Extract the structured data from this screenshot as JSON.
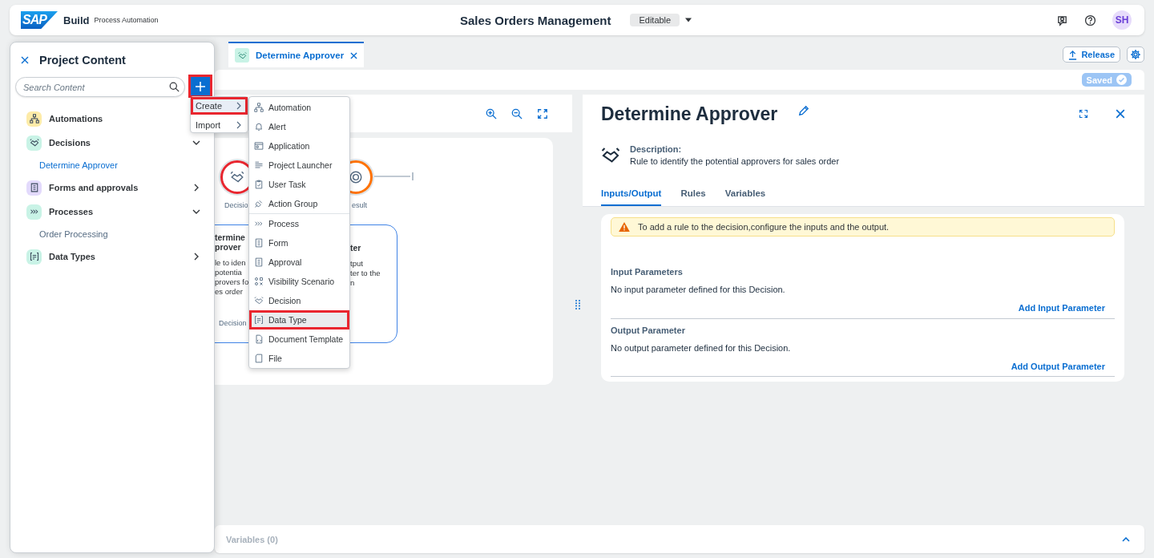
{
  "header": {
    "logo": "SAP",
    "product": "Build",
    "subtitle": "Process Automation",
    "title": "Sales Orders Management",
    "mode": "Editable",
    "user_initials": "SH"
  },
  "tabs": [
    {
      "label": "Determine Approver",
      "selected": true
    }
  ],
  "actions": {
    "release": "Release",
    "status": "Saved"
  },
  "project_panel": {
    "title": "Project Content",
    "search": {
      "placeholder": "Search Content"
    },
    "tree": [
      {
        "label": "Automations",
        "kind": "automation",
        "color": "#fdeba8"
      },
      {
        "label": "Decisions",
        "kind": "decision",
        "color": "#c9f3e6",
        "expanded": true,
        "children": [
          {
            "label": "Determine Approver",
            "selected": true
          }
        ]
      },
      {
        "label": "Forms and approvals",
        "kind": "form",
        "color": "#e3dafc",
        "expanded": false
      },
      {
        "label": "Processes",
        "kind": "process",
        "color": "#c9f3e6",
        "expanded": true,
        "children": [
          {
            "label": "Order Processing",
            "selected": false
          }
        ]
      },
      {
        "label": "Data Types",
        "kind": "data-type",
        "color": "#c9f3e6",
        "expanded": false
      }
    ]
  },
  "add_button": {
    "highlighted": true
  },
  "add_menu": [
    {
      "label": "Create",
      "highlighted": true
    },
    {
      "label": "Import",
      "highlighted": false
    }
  ],
  "create_menu": [
    [
      {
        "label": "Automation",
        "kind": "automation",
        "highlighted": false
      },
      {
        "label": "Alert",
        "kind": "alert",
        "highlighted": false
      },
      {
        "label": "Application",
        "kind": "application",
        "highlighted": false
      },
      {
        "label": "Project Launcher",
        "kind": "project-launcher",
        "highlighted": false
      },
      {
        "label": "User Task",
        "kind": "user-task",
        "highlighted": false
      },
      {
        "label": "Action Group",
        "kind": "action-group",
        "highlighted": false
      }
    ],
    [
      {
        "label": "Process",
        "kind": "process",
        "highlighted": false
      },
      {
        "label": "Form",
        "kind": "form",
        "highlighted": false
      },
      {
        "label": "Approval",
        "kind": "approval",
        "highlighted": false
      },
      {
        "label": "Visibility Scenario",
        "kind": "visibility-scenario",
        "highlighted": false
      },
      {
        "label": "Decision",
        "kind": "decision",
        "highlighted": false
      },
      {
        "label": "Data Type",
        "kind": "data-type",
        "highlighted": true
      },
      {
        "label": "Document Template",
        "kind": "document-template",
        "highlighted": false
      },
      {
        "label": "File",
        "kind": "file",
        "highlighted": false
      }
    ]
  ],
  "canvas": {
    "decision_label": "Decisio",
    "result_label": "esult",
    "left_title": [
      "termine",
      "prover"
    ],
    "left_text": [
      "le to iden",
      "potentia",
      "provers fo",
      "es order"
    ],
    "left_type": "Decision",
    "right_title": [
      "ter"
    ],
    "right_text": [
      "tput",
      "ter to the",
      "n"
    ]
  },
  "detail": {
    "title": "Determine Approver",
    "description_label": "Description:",
    "description": "Rule to identify the potential approvers for sales order",
    "tabs": [
      {
        "label": "Inputs/Output",
        "selected": true
      },
      {
        "label": "Rules",
        "selected": false
      },
      {
        "label": "Variables",
        "selected": false
      }
    ],
    "notice": "To add a rule to the decision,configure the inputs and the output.",
    "sections": [
      {
        "heading": "Input Parameters",
        "empty": "No input parameter defined for this Decision.",
        "action": "Add Input Parameter"
      },
      {
        "heading": "Output Parameter",
        "empty": "No output parameter defined for this Decision.",
        "action": "Add Output Parameter"
      }
    ]
  },
  "bottom_bar": {
    "label": "Variables (0)"
  }
}
